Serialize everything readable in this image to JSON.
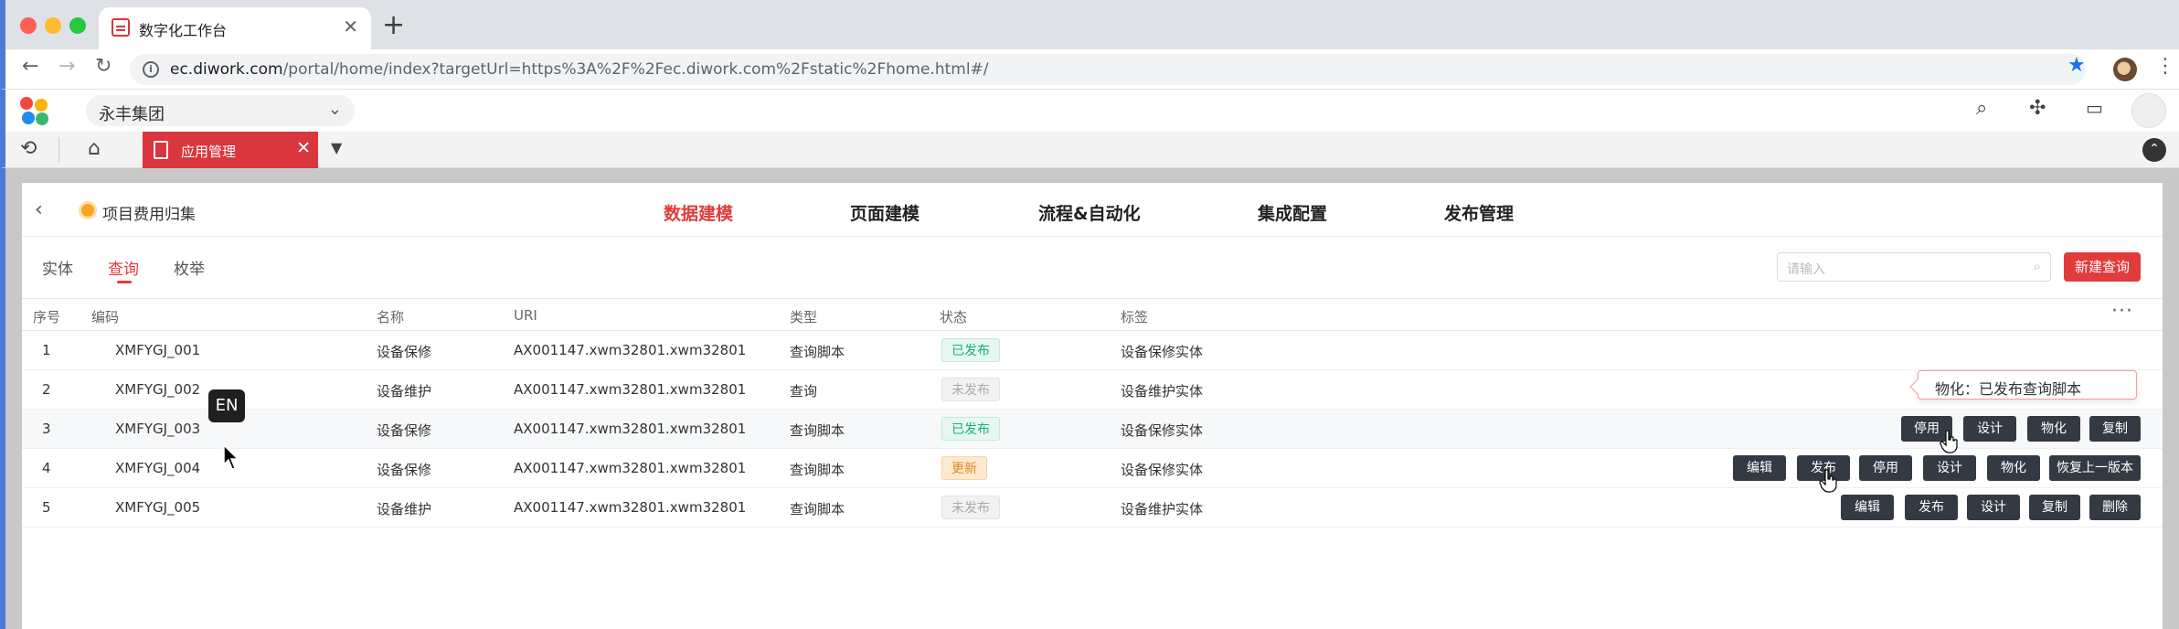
{
  "browser": {
    "tab_title": "数字化工作台",
    "url_host": "ec.diwork.com",
    "url_path": "/portal/home/index?targetUrl=https%3A%2F%2Fec.diwork.com%2Fstatic%2Fhome.html#/"
  },
  "header": {
    "org_name": "永丰集团",
    "app_tab_label": "应用管理"
  },
  "project": {
    "name": "项目费用归集"
  },
  "top_nav": [
    "数据建模",
    "页面建模",
    "流程&自动化",
    "集成配置",
    "发布管理"
  ],
  "sub_tabs": [
    "实体",
    "查询",
    "枚举"
  ],
  "search": {
    "placeholder": "请输入"
  },
  "new_query_label": "新建查询",
  "table": {
    "headers": [
      "序号",
      "编码",
      "名称",
      "URI",
      "类型",
      "状态",
      "标签"
    ],
    "rows": [
      {
        "no": "1",
        "code": "XMFYGJ_001",
        "name": "设备保修",
        "uri": "AX001147.xwm32801.xwm32801",
        "type": "查询脚本",
        "status": "已发布",
        "tag": "设备保修实体"
      },
      {
        "no": "2",
        "code": "XMFYGJ_002",
        "name": "设备维护",
        "uri": "AX001147.xwm32801.xwm32801",
        "type": "查询",
        "status": "未发布",
        "tag": "设备维护实体"
      },
      {
        "no": "3",
        "code": "XMFYGJ_003",
        "name": "设备保修",
        "uri": "AX001147.xwm32801.xwm32801",
        "type": "查询脚本",
        "status": "已发布",
        "tag": "设备保修实体"
      },
      {
        "no": "4",
        "code": "XMFYGJ_004",
        "name": "设备保修",
        "uri": "AX001147.xwm32801.xwm32801",
        "type": "查询脚本",
        "status": "更新",
        "tag": "设备保修实体"
      },
      {
        "no": "5",
        "code": "XMFYGJ_005",
        "name": "设备维护",
        "uri": "AX001147.xwm32801.xwm32801",
        "type": "查询脚本",
        "status": "未发布",
        "tag": "设备维护实体"
      }
    ]
  },
  "actions": {
    "row3": [
      "停用",
      "设计",
      "物化",
      "复制"
    ],
    "row4": [
      "编辑",
      "发布",
      "停用",
      "设计",
      "物化",
      "恢复上一版本"
    ],
    "row5": [
      "编辑",
      "发布",
      "设计",
      "复制",
      "删除"
    ]
  },
  "tooltip": "物化：已发布查询脚本",
  "ime_indicator": "EN",
  "colors": {
    "accent_red": "#e23b3b",
    "published_green": "#1fae7a",
    "update_orange": "#e08a1e",
    "action_button_dark": "#333a44"
  }
}
